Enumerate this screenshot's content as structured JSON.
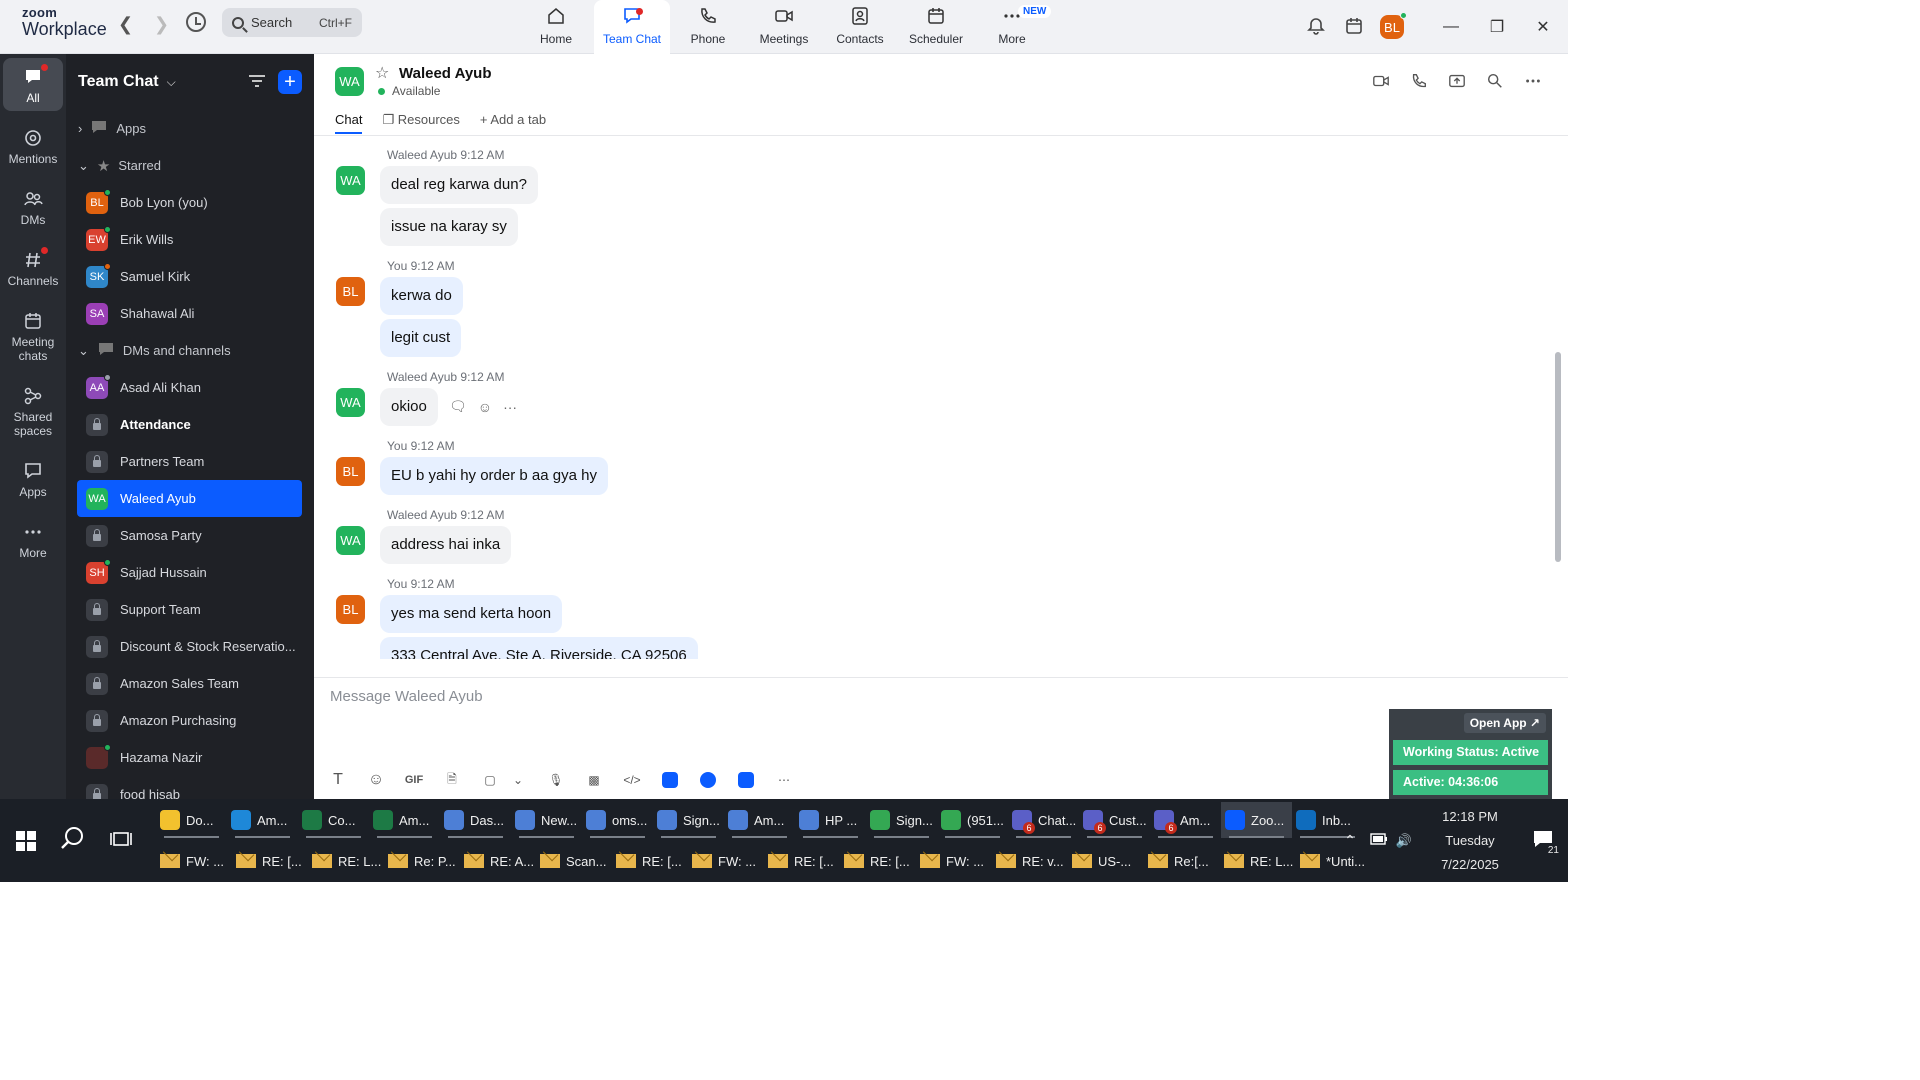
{
  "app": {
    "logo_line1": "zoom",
    "logo_line2": "Workplace",
    "search_placeholder": "Search",
    "search_shortcut": "Ctrl+F"
  },
  "nav_tabs": [
    {
      "label": "Home",
      "icon": "home-icon",
      "active": false
    },
    {
      "label": "Team Chat",
      "icon": "chat-icon",
      "active": true
    },
    {
      "label": "Phone",
      "icon": "phone-icon",
      "active": false
    },
    {
      "label": "Meetings",
      "icon": "video-icon",
      "active": false
    },
    {
      "label": "Contacts",
      "icon": "contacts-icon",
      "active": false
    },
    {
      "label": "Scheduler",
      "icon": "calendar-icon",
      "active": false
    },
    {
      "label": "More",
      "icon": "more-icon",
      "active": false,
      "badge": "NEW"
    }
  ],
  "user_avatar": "BL",
  "rail": [
    {
      "label": "All",
      "active": true
    },
    {
      "label": "Mentions"
    },
    {
      "label": "DMs"
    },
    {
      "label": "Channels"
    },
    {
      "label": "Meeting chats"
    },
    {
      "label": "Shared spaces"
    },
    {
      "label": "Apps"
    },
    {
      "label": "More"
    }
  ],
  "sidebar": {
    "title": "Team Chat",
    "apps_label": "Apps",
    "starred_label": "Starred",
    "dms_label": "DMs and channels",
    "starred": [
      {
        "initials": "BL",
        "name": "Bob Lyon (you)",
        "color": "#e0620f",
        "presence": "#22b35c"
      },
      {
        "initials": "EW",
        "name": "Erik Wills",
        "color": "#d9412f",
        "presence": "#22b35c"
      },
      {
        "initials": "SK",
        "name": "Samuel Kirk",
        "color": "#2f87c9",
        "presence": "#e0620f"
      },
      {
        "initials": "SA",
        "name": "Shahawal Ali",
        "color": "#9b3fb5",
        "presence": ""
      }
    ],
    "dms": [
      {
        "type": "avatar",
        "initials": "AA",
        "name": "Asad Ali Khan",
        "color": "#8e4ab8",
        "presence": "#9aa0aa"
      },
      {
        "type": "lock",
        "name": "Attendance",
        "bold": true
      },
      {
        "type": "lock",
        "name": "Partners Team"
      },
      {
        "type": "avatar",
        "initials": "WA",
        "name": "Waleed Ayub",
        "color": "#22b35c",
        "presence": "",
        "active": true
      },
      {
        "type": "lock",
        "name": "Samosa Party"
      },
      {
        "type": "avatar",
        "initials": "SH",
        "name": "Sajjad Hussain",
        "color": "#d9412f",
        "presence": "#22b35c"
      },
      {
        "type": "lock",
        "name": "Support Team"
      },
      {
        "type": "lock",
        "name": "Discount & Stock Reservatio..."
      },
      {
        "type": "lock",
        "name": "Amazon Sales Team"
      },
      {
        "type": "lock",
        "name": "Amazon Purchasing"
      },
      {
        "type": "avatar",
        "initials": "",
        "name": "Hazama Nazir",
        "color": "#5a2a2a",
        "presence": "#22b35c"
      },
      {
        "type": "lock",
        "name": "food hisab"
      }
    ]
  },
  "chat": {
    "contact_initials": "WA",
    "contact_name": "Waleed Ayub",
    "status": "Available",
    "tabs": [
      "Chat",
      "Resources",
      "Add a tab"
    ],
    "composer_placeholder": "Message Waleed Ayub"
  },
  "messages": [
    {
      "initials": "WA",
      "sender": "Waleed Ayub",
      "time": "9:12 AM",
      "mine": false,
      "bubbles": [
        "deal reg karwa dun?",
        "issue na karay sy"
      ]
    },
    {
      "initials": "BL",
      "sender": "You",
      "time": "9:12 AM",
      "mine": true,
      "bubbles": [
        "kerwa do",
        "legit cust"
      ]
    },
    {
      "initials": "WA",
      "sender": "Waleed Ayub",
      "time": "9:12 AM",
      "mine": false,
      "bubbles": [
        "okioo"
      ],
      "hover": true
    },
    {
      "initials": "BL",
      "sender": "You",
      "time": "9:12 AM",
      "mine": true,
      "bubbles": [
        "EU b yahi hy order b aa gya hy"
      ]
    },
    {
      "initials": "WA",
      "sender": "Waleed Ayub",
      "time": "9:12 AM",
      "mine": false,
      "bubbles": [
        "address hai inka"
      ]
    },
    {
      "initials": "BL",
      "sender": "You",
      "time": "9:12 AM",
      "mine": true,
      "bubbles": [
        "yes ma send kerta hoon",
        "333 Central Ave. Ste A. Riverside, CA 92506"
      ]
    }
  ],
  "widget": {
    "open_app": "Open App ↗",
    "working_status": "Working Status: Active",
    "active_timer": "Active: 04:36:06"
  },
  "taskbar": {
    "row1": [
      {
        "label": "Do...",
        "color": "#f2c12e"
      },
      {
        "label": "Am...",
        "color": "#1e88d8"
      },
      {
        "label": "Co...",
        "color": "#1d7a45"
      },
      {
        "label": "Am...",
        "color": "#1d7a45"
      },
      {
        "label": "Das...",
        "color": "#4d7fd6"
      },
      {
        "label": "New...",
        "color": "#4d7fd6"
      },
      {
        "label": "oms...",
        "color": "#4d7fd6"
      },
      {
        "label": "Sign...",
        "color": "#4d7fd6"
      },
      {
        "label": "Am...",
        "color": "#4d7fd6"
      },
      {
        "label": "HP ...",
        "color": "#4d7fd6"
      },
      {
        "label": "Sign...",
        "color": "#34a853"
      },
      {
        "label": "(951...",
        "color": "#34a853"
      },
      {
        "label": "Chat...",
        "color": "#5b5fc7",
        "badge": "6"
      },
      {
        "label": "Cust...",
        "color": "#5b5fc7",
        "badge": "6"
      },
      {
        "label": "Am...",
        "color": "#5b5fc7",
        "badge": "6"
      },
      {
        "label": "Zoo...",
        "color": "#0b5cff",
        "active": true
      },
      {
        "label": "Inb...",
        "color": "#0f6cbd"
      }
    ],
    "row2": [
      "FW: ...",
      "RE: [...",
      "RE: L...",
      "Re: P...",
      "RE: A...",
      "Scan...",
      "RE: [...",
      "FW: ...",
      "RE: [...",
      "RE: [...",
      "FW: ...",
      "RE: v...",
      "US-...",
      "Re:[...",
      "RE: L...",
      "*Unti..."
    ],
    "time": "12:18 PM",
    "day": "Tuesday",
    "date": "7/22/2025",
    "notifications": "21"
  }
}
